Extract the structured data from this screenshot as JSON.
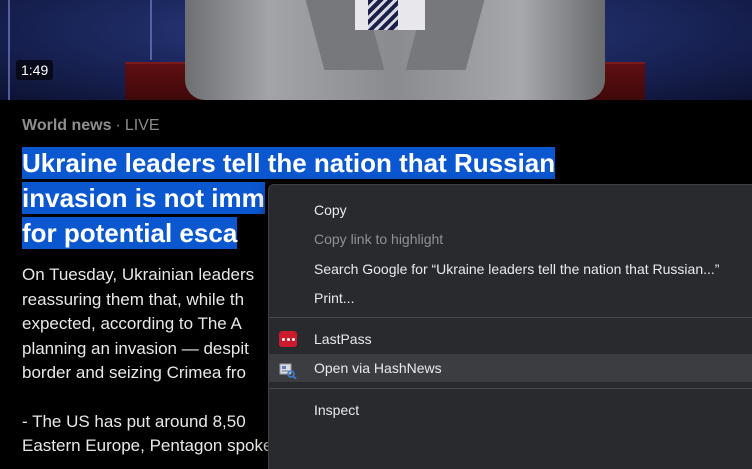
{
  "video": {
    "duration": "1:49"
  },
  "article": {
    "section": "World news",
    "separator": "·",
    "status": "LIVE",
    "headline_lines": [
      "Ukraine leaders tell the nation that Russian ",
      "invasion is not imm",
      "for potential esca"
    ],
    "body_lines": [
      "On Tuesday, Ukrainian leaders",
      "reassuring them that, while th",
      "expected, according to The A",
      "planning an invasion — despit",
      "border and seizing Crimea fro",
      "",
      "- The US has put around 8,50",
      "Eastern Europe, Pentagon spokesperson John Kirby said on Monday, but President"
    ]
  },
  "context_menu": {
    "copy": "Copy",
    "copy_link": "Copy link to highlight",
    "search_google": "Search Google for “Ukraine leaders tell the nation that Russian...”",
    "print": "Print...",
    "lastpass": "LastPass",
    "hashnews": "Open via HashNews",
    "inspect": "Inspect"
  }
}
